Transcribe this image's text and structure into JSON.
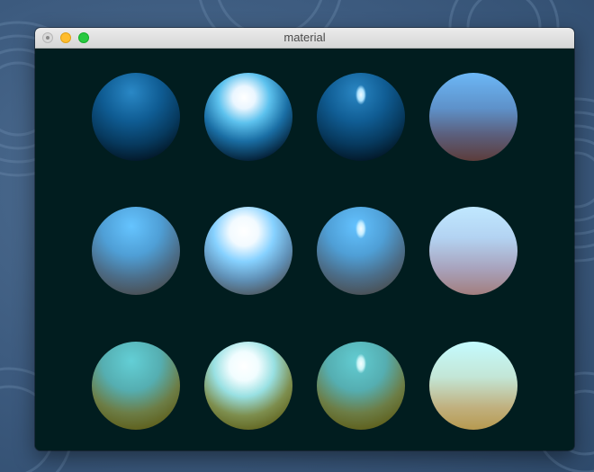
{
  "window": {
    "title": "material"
  },
  "colors": {
    "canvas_background": "#011d1f",
    "close_button": "#d9d9d9",
    "minimize_button": "#ffbd2e",
    "zoom_button": "#28c940"
  },
  "spheres": {
    "rows": [
      [
        "sphere-dark-diffuse",
        "sphere-dark-bright-specular",
        "sphere-dark-sharp-specular",
        "sphere-dark-emissive"
      ],
      [
        "sphere-blue-diffuse",
        "sphere-blue-bright-specular",
        "sphere-blue-sharp-specular",
        "sphere-blue-emissive"
      ],
      [
        "sphere-teal-diffuse",
        "sphere-teal-bright-specular",
        "sphere-teal-sharp-specular",
        "sphere-teal-emissive"
      ]
    ]
  }
}
